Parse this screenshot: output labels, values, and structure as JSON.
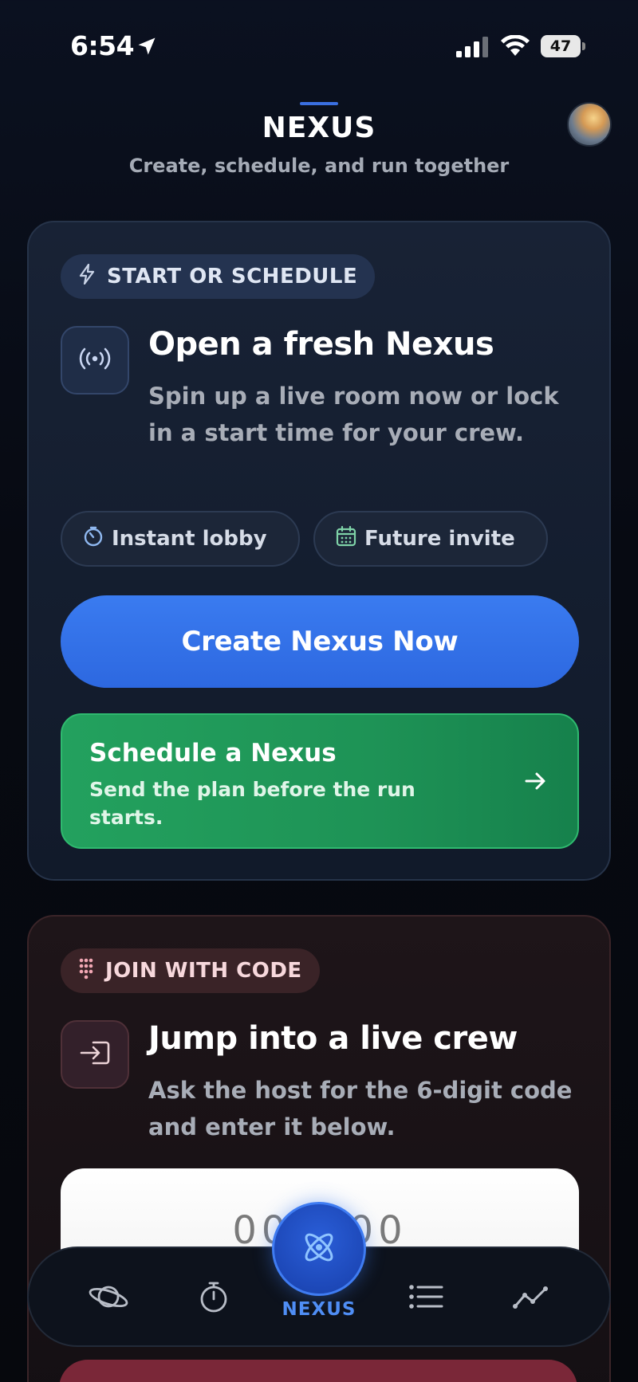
{
  "status_bar": {
    "time": "6:54",
    "battery": "47"
  },
  "header": {
    "title": "NEXUS",
    "subtitle": "Create, schedule, and run together"
  },
  "start_card": {
    "tag": "START OR SCHEDULE",
    "heading": "Open a fresh Nexus",
    "description": "Spin up a live room now or lock in a start time for your crew.",
    "chips": [
      {
        "label": "Instant lobby",
        "icon": "stopwatch-icon"
      },
      {
        "label": "Future invite",
        "icon": "calendar-icon"
      }
    ],
    "create_button": "Create Nexus Now",
    "schedule_button": {
      "title": "Schedule a Nexus",
      "subtitle": "Send the plan before the run starts."
    }
  },
  "join_card": {
    "tag": "JOIN WITH CODE",
    "heading": "Jump into a live crew",
    "description": "Ask the host for the 6-digit code and enter it below.",
    "code_placeholder": "000000"
  },
  "tab_bar": {
    "tabs": [
      {
        "icon": "planet-icon"
      },
      {
        "icon": "stopwatch-icon"
      },
      {
        "icon": "atom-icon",
        "label": "NEXUS",
        "active": true
      },
      {
        "icon": "list-icon"
      },
      {
        "icon": "chart-line-icon"
      }
    ]
  },
  "colors": {
    "accent_blue": "#2d68e0",
    "accent_green": "#1e9356",
    "join_accent": "#7a2738"
  }
}
